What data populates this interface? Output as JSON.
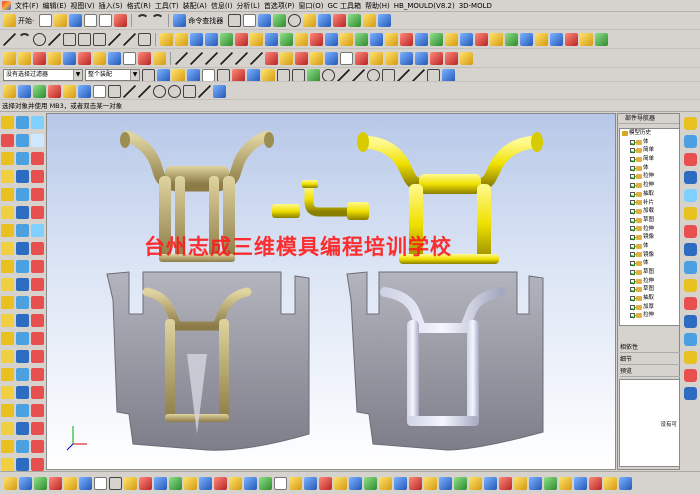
{
  "menubar": {
    "items": [
      "文件(F)",
      "编辑(E)",
      "视图(V)",
      "插入(S)",
      "格式(R)",
      "工具(T)",
      "装配(A)",
      "信息(I)",
      "分析(L)",
      "首选项(P)",
      "窗口(O)",
      "GC 工具箱",
      "帮助(H)",
      "HB_MOULD(V8.2)",
      "3D-MOLD"
    ]
  },
  "toolbar": {
    "start_label": "开始·",
    "command_finder_label": "命令查找器"
  },
  "selection": {
    "filter_value": "没有选择过滤器",
    "assembly_value": "整个装配"
  },
  "status": {
    "prompt": "选择对象并使用 MB3，或者双击某一对象"
  },
  "watermark": {
    "text": "台州志成三维模具编程培训学校"
  },
  "navigator": {
    "title": "部件导航器",
    "tree": [
      {
        "label": "模型历史",
        "top": true
      },
      {
        "label": "体"
      },
      {
        "label": "简单"
      },
      {
        "label": "简单"
      },
      {
        "label": "体"
      },
      {
        "label": "拉伸"
      },
      {
        "label": "拉伸"
      },
      {
        "label": "抽取"
      },
      {
        "label": "补片"
      },
      {
        "label": "加载"
      },
      {
        "label": "草图"
      },
      {
        "label": "拉伸"
      },
      {
        "label": "镜像"
      },
      {
        "label": "体"
      },
      {
        "label": "镜像"
      },
      {
        "label": "体"
      },
      {
        "label": "草图"
      },
      {
        "label": "拉伸"
      },
      {
        "label": "草图"
      },
      {
        "label": "抽取"
      },
      {
        "label": "加厚"
      },
      {
        "label": "拉伸"
      }
    ],
    "dependents_label": "相依性",
    "details_label": "细节",
    "preview_label": "预览",
    "preview_empty": "没有可"
  },
  "colors": {
    "viewport_top": "#b7c8e8",
    "part_yellow": "#f0e000",
    "part_sand": "#c2b170",
    "mold_grey": "#9b9ba6",
    "watermark": "#ff1a1a"
  }
}
